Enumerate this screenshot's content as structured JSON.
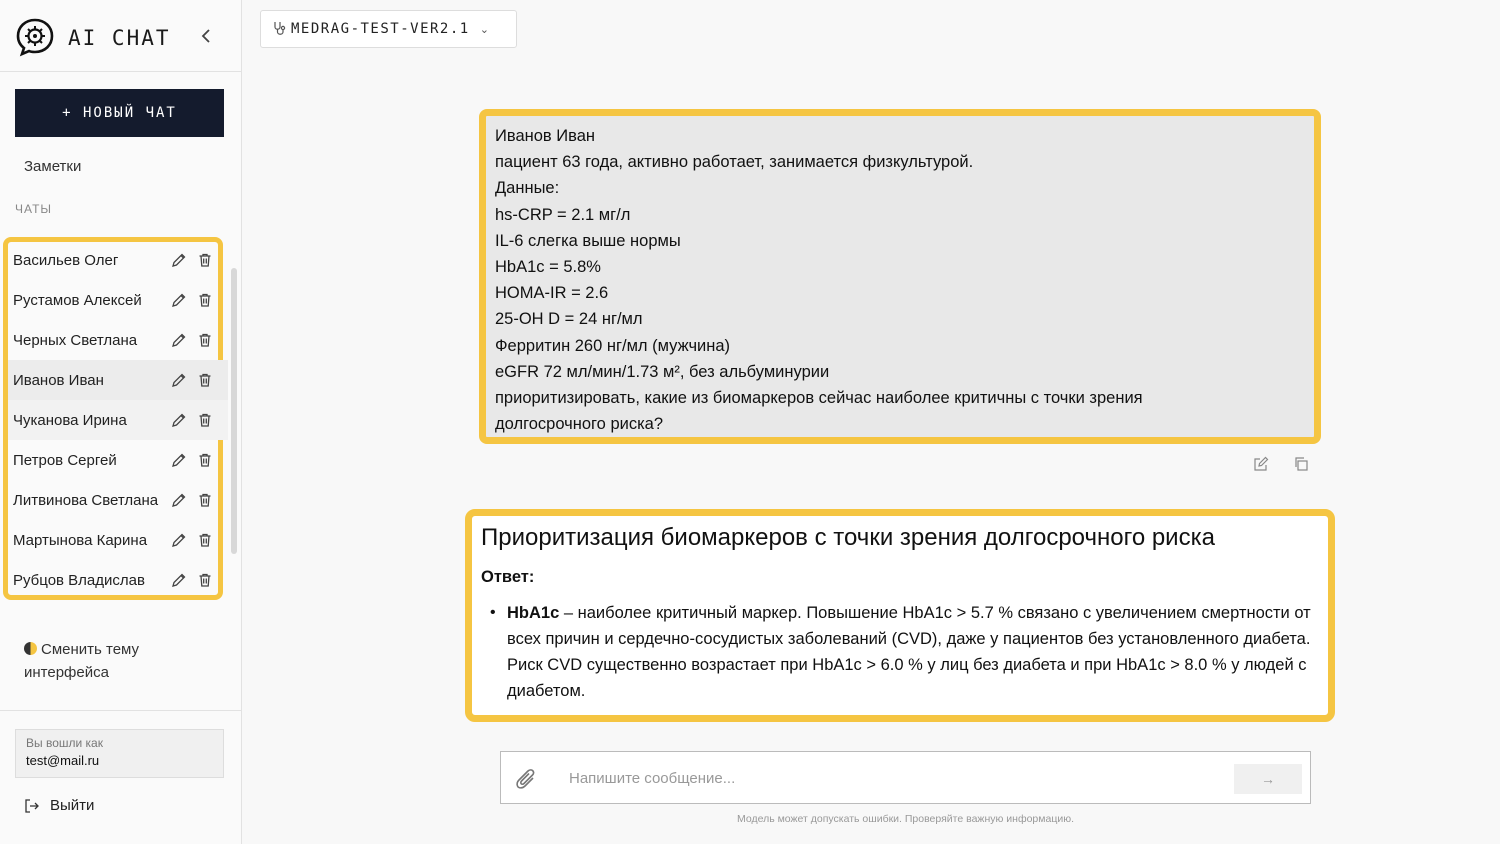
{
  "app": {
    "title": "AI CHAT"
  },
  "sidebar": {
    "new_chat_label": "+ НОВЫЙ ЧАТ",
    "notes_label": "Заметки",
    "chats_section_label": "ЧАТЫ",
    "chats": [
      {
        "name": "Васильев Олег"
      },
      {
        "name": "Рустамов Алексей"
      },
      {
        "name": "Черных Светлана"
      },
      {
        "name": "Иванов Иван"
      },
      {
        "name": "Чуканова Ирина"
      },
      {
        "name": "Петров Сергей"
      },
      {
        "name": "Литвинова Светлана"
      },
      {
        "name": "Мартынова Карина"
      },
      {
        "name": "Рубцов Владислав"
      }
    ],
    "theme_toggle_label": "Сменить тему интерфейса",
    "login": {
      "label": "Вы вошли как",
      "email": "test@mail.ru"
    },
    "logout_label": "Выйти"
  },
  "header": {
    "model_name": "MEDRAG-TEST-VER2.1"
  },
  "conversation": {
    "user_message": [
      "Иванов Иван",
      "пациент 63 года, активно работает, занимается физкультурой.",
      "Данные:",
      "hs-CRP = 2.1 мг/л",
      "IL-6 слегка выше нормы",
      "HbA1c = 5.8%",
      "HOMA-IR = 2.6",
      "25-OH D = 24 нг/мл",
      "Ферритин 260 нг/мл (мужчина)",
      "eGFR 72 мл/мин/1.73 м², без альбуминурии",
      "приоритизировать, какие из биомаркеров сейчас наиболее критичны с точки зрения",
      "долгосрочного риска?"
    ],
    "answer": {
      "title": "Приоритизация биомаркеров с точки зрения долгосрочного риска",
      "label": "Ответ:",
      "items": [
        {
          "term": "HbA1c",
          "text": " – наиболее критичный маркер. Повышение HbA1c > 5.7 % связано с увеличением смертности от всех причин и сердечно-сосудистых заболеваний (CVD), даже у пациентов без установленного диабета. Риск CVD существенно возрастает при HbA1c > 6.0 % у лиц без диабета и при HbA1c > 8.0 % у людей с диабетом."
        }
      ]
    }
  },
  "composer": {
    "placeholder": "Напишите сообщение...",
    "send_label": "→",
    "disclaimer": "Модель может допускать ошибки. Проверяйте важную информацию."
  },
  "colors": {
    "highlight": "#f5c542",
    "new_chat_bg": "#141b2d"
  }
}
